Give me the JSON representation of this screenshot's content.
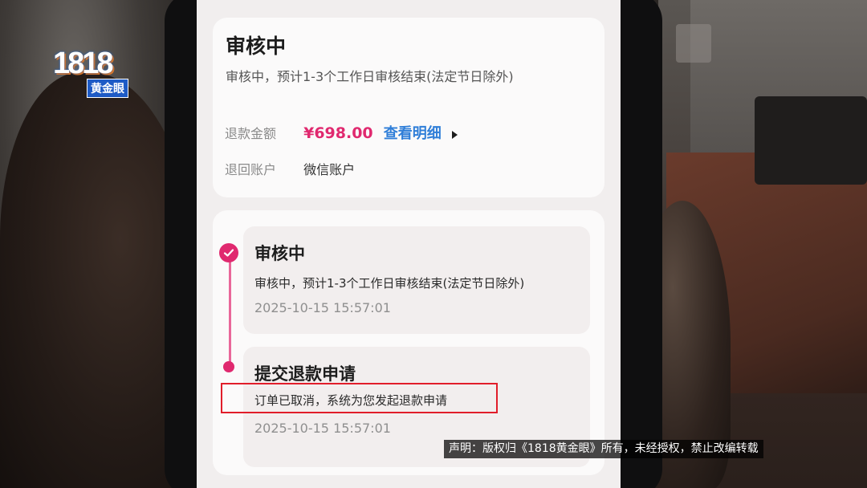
{
  "refund": {
    "status_title": "审核中",
    "status_desc": "审核中，预计1-3个工作日审核结束(法定节日除外)",
    "amount_label": "退款金额",
    "amount_value": "¥698.00",
    "detail_link": "查看明细",
    "account_label": "退回账户",
    "account_value": "微信账户"
  },
  "timeline": [
    {
      "title": "审核中",
      "desc": "审核中，预计1-3个工作日审核结束(法定节日除外)",
      "time": "2025-10-15 15:57:01"
    },
    {
      "title": "提交退款申请",
      "desc": "订单已取消，系统为您发起退款申请",
      "time": "2025-10-15 15:57:01"
    }
  ],
  "overlay": {
    "logo_number": "1818",
    "logo_text": "黄金眼",
    "disclaimer": "声明：版权归《1818黄金眼》所有，未经授权，禁止改编转载"
  },
  "colors": {
    "accent": "#e0296f",
    "link": "#2f7ed8",
    "highlight_box": "#e11d2a"
  },
  "icons": {
    "timeline_done": "check-circle-icon",
    "detail_arrow": "triangle-right-icon"
  }
}
